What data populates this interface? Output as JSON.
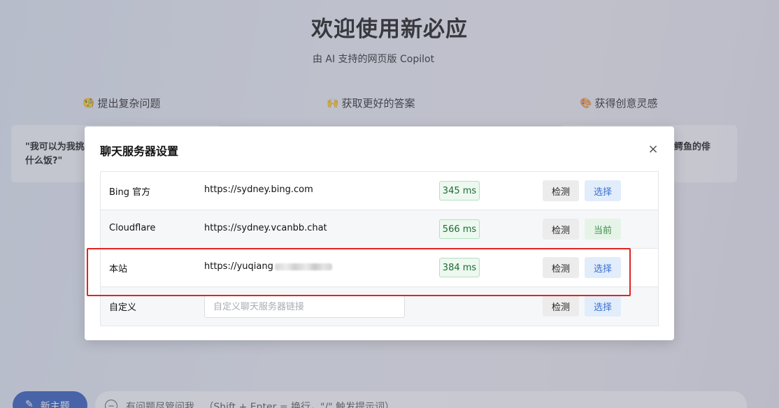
{
  "background": {
    "title": "欢迎使用新必应",
    "subtitle": "由 AI 支持的网页版 Copilot",
    "features": [
      {
        "emoji": "🧐",
        "label": "提出复杂问题"
      },
      {
        "emoji": "🙌",
        "label": "获取更好的答案"
      },
      {
        "emoji": "🎨",
        "label": "获得创意灵感"
      }
    ],
    "prompt_left": "\"我可以为我挑\n什么饭?\"",
    "prompt_right": "鳄鱼的俳",
    "new_topic_label": "新主题",
    "chat_placeholder": "有问题尽管问我...（Shift + Enter = 换行，\"/\" 触发提示词）"
  },
  "modal": {
    "title": "聊天服务器设置",
    "close_symbol": "×",
    "rows": [
      {
        "name": "Bing 官方",
        "url": "https://sydney.bing.com",
        "latency": "345 ms",
        "check": "检测",
        "select": "选择",
        "current": false
      },
      {
        "name": "Cloudflare",
        "url": "https://sydney.vcanbb.chat",
        "latency": "566 ms",
        "check": "检测",
        "select": "当前",
        "current": true
      },
      {
        "name": "本站",
        "url": "https://yuqiang",
        "latency": "384 ms",
        "check": "检测",
        "select": "选择",
        "current": false
      }
    ],
    "custom": {
      "name": "自定义",
      "placeholder": "自定义聊天服务器链接",
      "check": "检测",
      "select": "选择"
    }
  },
  "colors": {
    "accent": "#3a6fd0",
    "latency_green": "#1d6b33",
    "highlight_red": "#e02323",
    "new_topic_bg": "#2a55b9"
  }
}
